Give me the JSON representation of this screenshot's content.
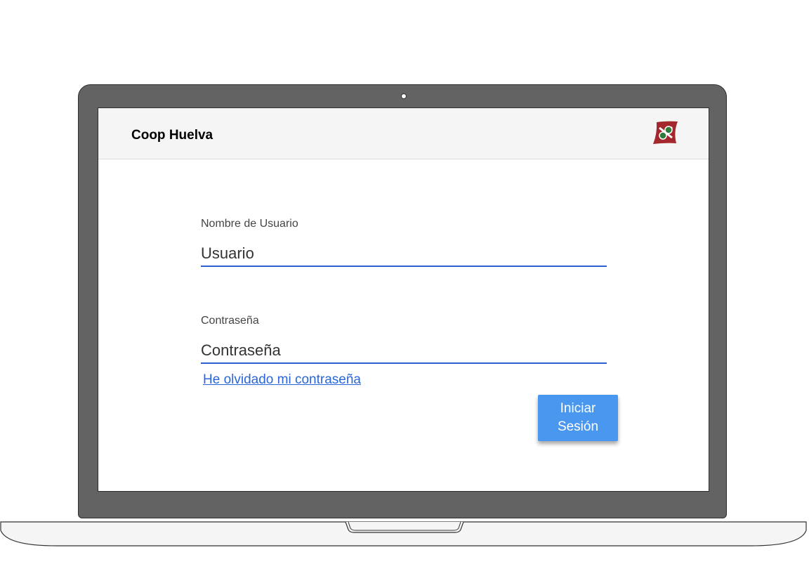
{
  "header": {
    "title": "Coop Huelva",
    "logo_icon": "coop-huelva-logo-icon"
  },
  "login_form": {
    "username": {
      "label": "Nombre de Usuario",
      "placeholder": "Usuario",
      "value": ""
    },
    "password": {
      "label": "Contraseña",
      "placeholder": "Contraseña",
      "value": ""
    },
    "forgot_password_link": "He olvidado mi contraseña",
    "submit_label": "Iniciar Sesión"
  },
  "colors": {
    "accent": "#4a97ef",
    "link": "#2a66d9",
    "input_underline": "#2d5fcf",
    "logo_red": "#a4272d",
    "logo_green": "#2f7b3a",
    "bezel": "#636363"
  }
}
